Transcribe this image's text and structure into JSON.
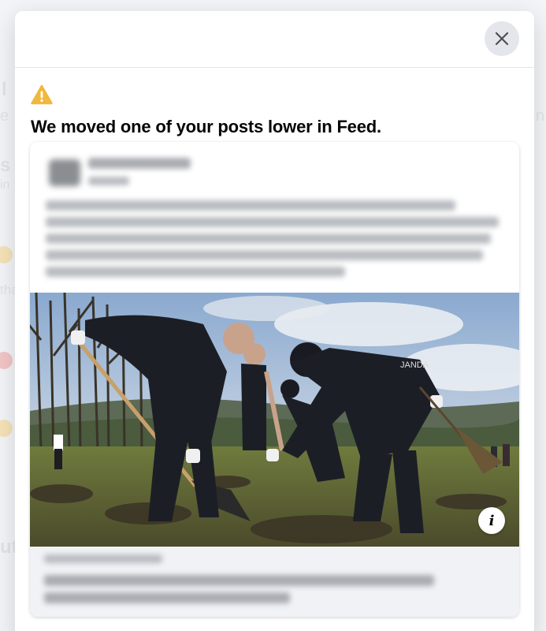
{
  "dialog": {
    "title": "We moved one of your posts lower in Feed.",
    "close_icon": "close-icon",
    "warning_icon": "warning-triangle-icon"
  },
  "post_preview": {
    "author": "",
    "content_blurred": true,
    "photo_subject": "People in dark uniforms planting trees in a field",
    "photo_visible_text": "JANDA",
    "info_icon": "info-icon",
    "info_glyph": "i"
  },
  "background": {
    "fragments": [
      "l",
      "e",
      "s",
      "in",
      "tha",
      "ut",
      "n"
    ]
  },
  "colors": {
    "warning": "#f0b83c",
    "close_button_bg": "#e4e6eb",
    "footer_bg": "#f0f2f5",
    "title_text": "#050505"
  }
}
